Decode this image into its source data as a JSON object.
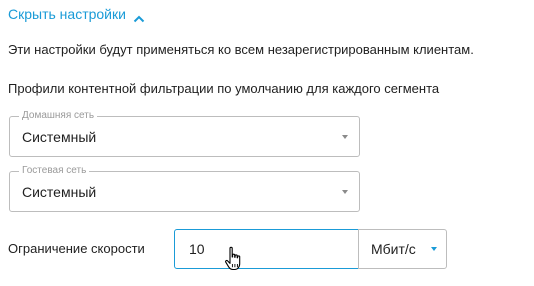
{
  "toggle": {
    "label": "Скрыть настройки",
    "icon": "chevron-up-icon",
    "color": "#1a9bd7"
  },
  "info_text": "Эти настройки будут применяться ко всем незарегистрированным клиентам.",
  "profiles": {
    "heading": "Профили контентной фильтрации по умолчанию для каждого сегмента",
    "home": {
      "legend": "Домашняя сеть",
      "value": "Системный"
    },
    "guest": {
      "legend": "Гостевая сеть",
      "value": "Системный"
    }
  },
  "speed_limit": {
    "label": "Ограничение скорости",
    "value": "10",
    "unit": "Мбит/с"
  },
  "colors": {
    "accent": "#1a9bd7",
    "border": "#bdbdbd",
    "legend": "#9a9a9a"
  }
}
